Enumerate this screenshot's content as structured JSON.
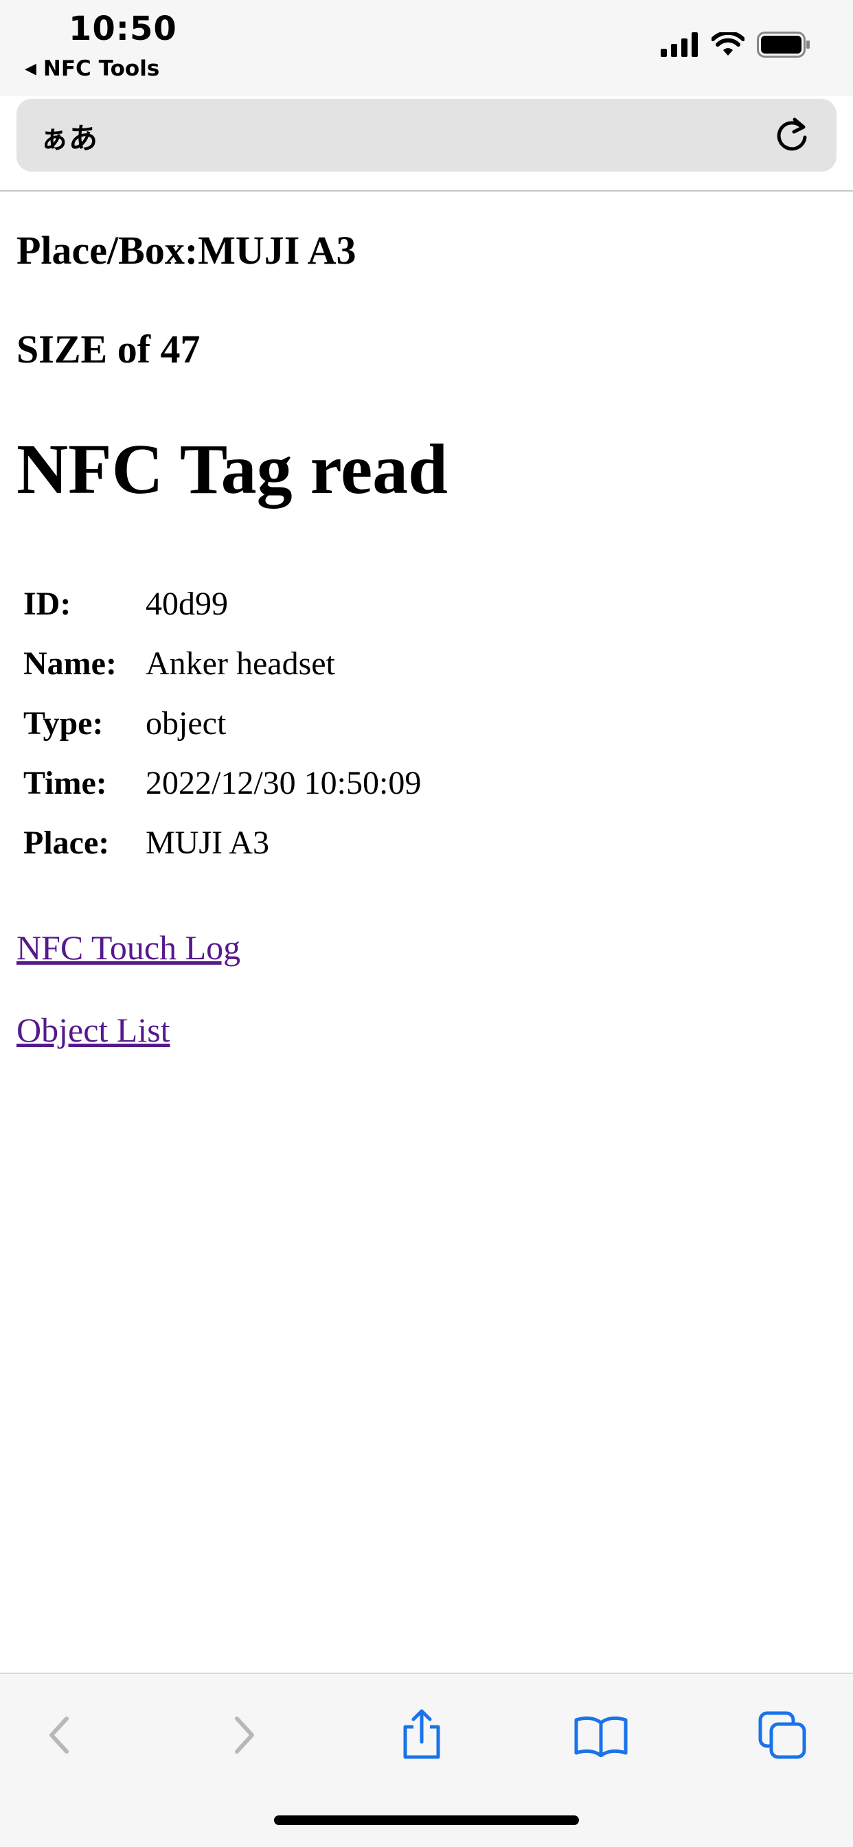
{
  "status_bar": {
    "time": "10:50",
    "back_app": "NFC Tools",
    "back_arrow": "◀"
  },
  "address_bar": {
    "text_size_label": "ぁあ"
  },
  "page": {
    "place_box": "Place/Box:MUJI A3",
    "size": "SIZE of 47",
    "title": "NFC Tag read",
    "info": [
      {
        "label": "ID:",
        "value": "40d99"
      },
      {
        "label": "Name:",
        "value": "Anker headset"
      },
      {
        "label": "Type:",
        "value": "object"
      },
      {
        "label": "Time:",
        "value": "2022/12/30 10:50:09"
      },
      {
        "label": "Place:",
        "value": "MUJI A3"
      }
    ],
    "links": {
      "touch_log": "NFC Touch Log",
      "object_list": "Object List"
    },
    "link_color": "#551a8b"
  },
  "toolbar": {
    "icons": [
      "back-icon",
      "forward-icon",
      "share-icon",
      "bookmarks-icon",
      "tabs-icon"
    ],
    "accent": "#1a73e8"
  }
}
